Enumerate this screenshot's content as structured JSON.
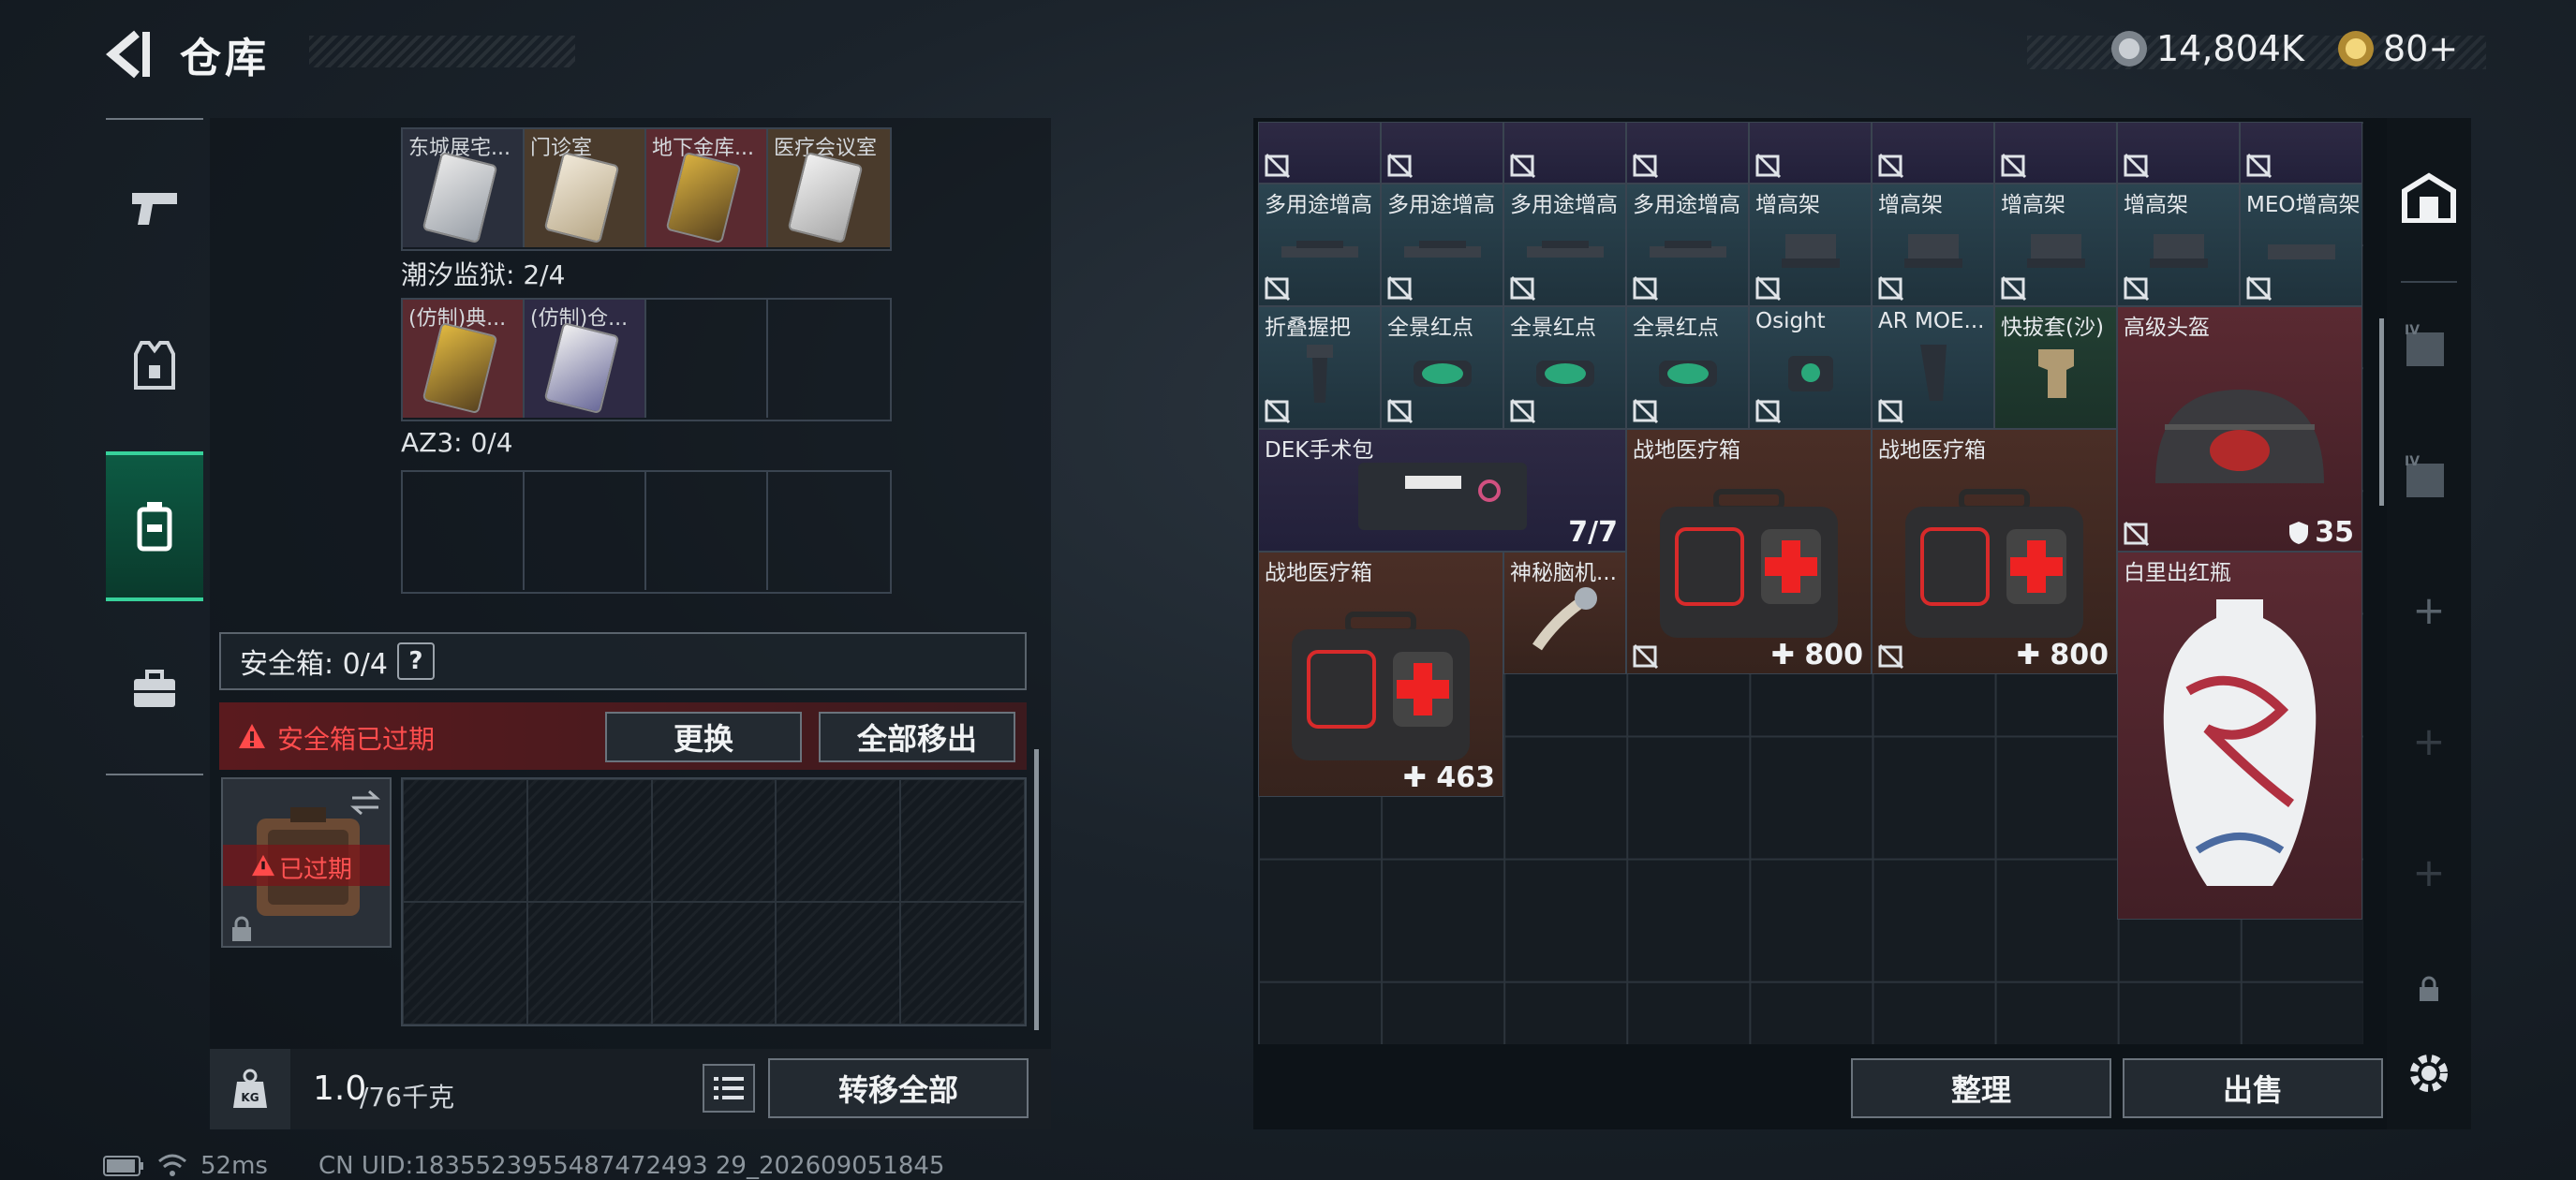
{
  "header": {
    "title": "仓库",
    "currency1": "14,804K",
    "currency2": "80+"
  },
  "keycards": [
    {
      "label": "东城展宅..."
    },
    {
      "label": "门诊室"
    },
    {
      "label": "地下金库..."
    },
    {
      "label": "医疗会议室"
    }
  ],
  "prison": {
    "title": "潮汐监狱: 2/4",
    "cards": [
      {
        "label": "(仿制)典..."
      },
      {
        "label": "(仿制)仓..."
      }
    ]
  },
  "az3": {
    "title": "AZ3: 0/4"
  },
  "safebox": {
    "title": "安全箱: 0/4",
    "help": "?",
    "warning": "安全箱已过期",
    "replace": "更换",
    "remove_all": "全部移出",
    "slot_label": "已过期"
  },
  "footer_left": {
    "weight_main": "1.0",
    "weight_unit": "/76千克",
    "transfer_all": "转移全部"
  },
  "footer_right": {
    "organize": "整理",
    "sell": "出售"
  },
  "items": {
    "r2": [
      "多用途增高",
      "多用途增高",
      "多用途增高",
      "多用途增高",
      "增高架",
      "增高架",
      "增高架",
      "增高架",
      "MEO增高架"
    ],
    "r3": [
      "折叠握把",
      "全景红点",
      "全景红点",
      "全景红点",
      "Osight",
      "AR MOE...",
      "快拔套(沙)"
    ],
    "helmet": "高级头盔",
    "helmet_qty": "35",
    "dek": "DEK手术包",
    "dek_qty": "7/7",
    "medkit1": "战地医疗箱",
    "medkit1_qty": "800",
    "medkit2": "战地医疗箱",
    "medkit2_qty": "800",
    "medkit3": "战地医疗箱",
    "medkit3_qty": "463",
    "mystery": "神秘脑机...",
    "vase": "白里出红瓶"
  },
  "status": {
    "ping": "52ms",
    "uid": "CN UID:1835523955487472493 29_202609051845"
  }
}
